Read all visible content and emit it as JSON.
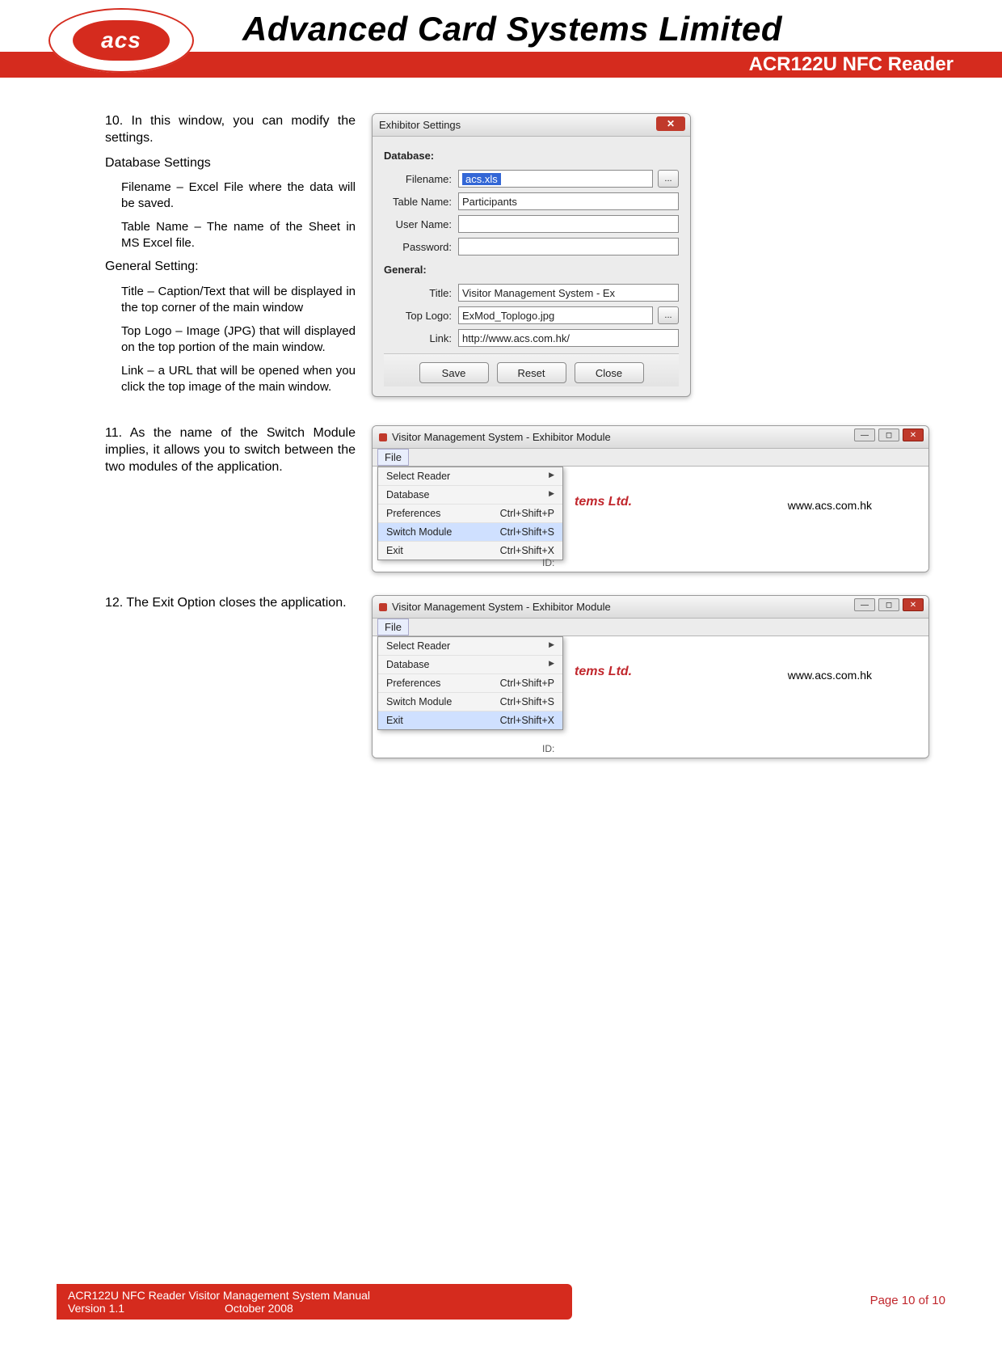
{
  "header": {
    "logo_text": "acs",
    "company": "Advanced Card Systems Limited",
    "product": "ACR122U NFC Reader"
  },
  "s10": {
    "intro": "10. In this window, you can modify the settings.",
    "db_heading": "Database Settings",
    "db_filename": "Filename – Excel File where the data will be saved.",
    "db_table": "Table Name – The name of the Sheet in MS Excel file.",
    "gen_heading": "General Setting:",
    "gen_title": "Title – Caption/Text that will be displayed in the top corner of the  main window",
    "gen_logo": "Top Logo – Image (JPG) that will displayed on the top portion of the main window.",
    "gen_link": "Link – a URL that will be opened when you click the top image of the main window."
  },
  "dlg_settings": {
    "title": "Exhibitor Settings",
    "grp_db": "Database:",
    "lbl_filename": "Filename:",
    "val_filename": "acs.xls",
    "lbl_table": "Table Name:",
    "val_table": "Participants",
    "lbl_user": "User Name:",
    "val_user": "",
    "lbl_pass": "Password:",
    "val_pass": "",
    "grp_gen": "General:",
    "lbl_title": "Title:",
    "val_title": "Visitor Management System - Ex",
    "lbl_logo": "Top Logo:",
    "val_logo": "ExMod_Toplogo.jpg",
    "lbl_link": "Link:",
    "val_link": "http://www.acs.com.hk/",
    "btn_save": "Save",
    "btn_reset": "Reset",
    "btn_close": "Close",
    "browse": "..."
  },
  "s11": {
    "text": "11. As the name of the Switch Module implies, it allows you to switch between the two modules of the application."
  },
  "s12": {
    "text": "12. The Exit Option closes the application."
  },
  "mod_window": {
    "title": "Visitor Management System - Exhibitor Module",
    "menu_file": "File",
    "items": {
      "select_reader": "Select Reader",
      "database": "Database",
      "preferences": "Preferences",
      "pref_sc": "Ctrl+Shift+P",
      "switch": "Switch Module",
      "switch_sc": "Ctrl+Shift+S",
      "exit": "Exit",
      "exit_sc": "Ctrl+Shift+X"
    },
    "brand_fragment": "tems Ltd.",
    "url": "www.acs.com.hk",
    "id_label": "ID:"
  },
  "footer": {
    "line1": "ACR122U NFC Reader Visitor Management System Manual",
    "v": "Version 1.1",
    "date": "October 2008",
    "page": "Page 10 of 10"
  }
}
